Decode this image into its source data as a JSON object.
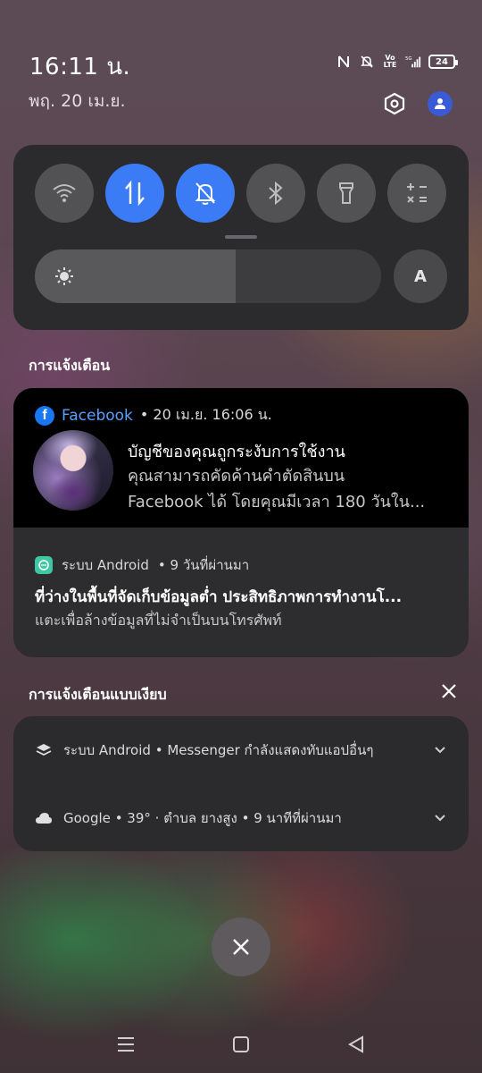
{
  "status_bar": {
    "time": "16:11 น.",
    "date": "พฤ. 20 เม.ย.",
    "battery": "24",
    "icons": [
      "nfc-icon",
      "mute-icon",
      "volte-icon",
      "signal-5g-icon",
      "battery-icon"
    ]
  },
  "quick_settings": {
    "tiles": [
      {
        "name": "wifi",
        "icon": "wifi-icon",
        "active": false
      },
      {
        "name": "mobile-data",
        "icon": "data-transfer-icon",
        "active": true
      },
      {
        "name": "silent",
        "icon": "bell-off-icon",
        "active": true
      },
      {
        "name": "bluetooth",
        "icon": "bluetooth-icon",
        "active": false
      },
      {
        "name": "flashlight",
        "icon": "flashlight-icon",
        "active": false
      },
      {
        "name": "calculator",
        "icon": "calculator-icon",
        "active": false
      }
    ],
    "brightness": 0.58,
    "auto_brightness_label": "A"
  },
  "notifications": {
    "section_label": "การแจ้งเตือน",
    "facebook": {
      "app": "Facebook",
      "meta": "• 20 เม.ย. 16:06 น.",
      "title": "บัญชีของคุณถูกระงับการใช้งาน",
      "body_line1": "คุณสามารถคัดค้านคำตัดสินบน",
      "body_line2": "Facebook ได้ โดยคุณมีเวลา 180 วันใน..."
    },
    "android": {
      "app": "ระบบ Android",
      "meta": "• 9 วันที่ผ่านมา",
      "title": "ที่ว่างในพื้นที่จัดเก็บข้อมูลต่ำ ประสิทธิภาพการทำงานโ...",
      "body": "แตะเพื่อล้างข้อมูลที่ไม่จำเป็นบนโทรศัพท์"
    }
  },
  "silent": {
    "section_label": "การแจ้งเตือนแบบเงียบ",
    "items": [
      {
        "app": "ระบบ Android",
        "text": "• Messenger กำลังแสดงทับแอปอื่นๆ",
        "icon": "layers-icon"
      },
      {
        "app": "Google",
        "text": "• 39° · ตำบล ยางสูง • 9 นาทีที่ผ่านมา",
        "icon": "cloud-icon"
      }
    ]
  },
  "colors": {
    "accent": "#3b7bf5",
    "panel": "#2b2a2c",
    "facebook_blue": "#1877f2"
  }
}
